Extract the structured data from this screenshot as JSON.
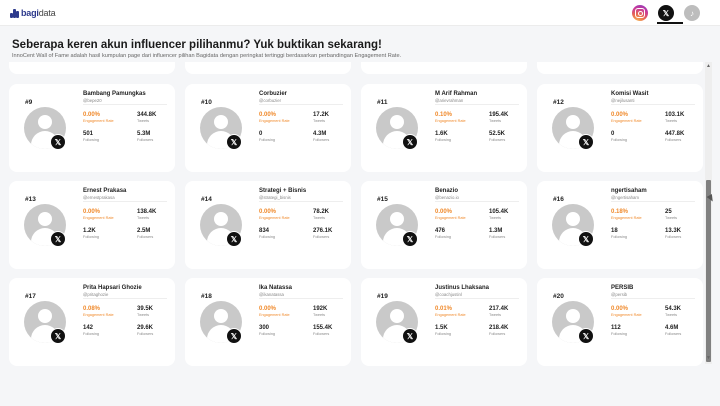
{
  "header": {
    "logo_bold": "bagi",
    "logo_thin": "data",
    "platforms": [
      {
        "name": "instagram",
        "icon": "instagram-icon"
      },
      {
        "name": "x",
        "icon": "x-logo-icon",
        "label": "𝕏",
        "active": true
      },
      {
        "name": "tiktok",
        "icon": "tiktok-icon",
        "label": "♪"
      }
    ]
  },
  "page": {
    "title": "Seberapa keren akun influencer pilihanmu? Yuk buktikan sekarang!",
    "subtitle": "InnoCent Wall of Fame adalah hasil kumpulan page dari influencer pilihan Bagidata dengan peringkat tertinggi berdasarkan perbandingan Engagement Rate."
  },
  "labels": {
    "engagement_rate": "Engagement Rate",
    "tweets": "Tweets",
    "following": "Following",
    "followers": "Followers",
    "x_badge": "𝕏"
  },
  "accent_color": "#f08a2c",
  "cards": [
    {
      "rank": "#9",
      "name": "Bambang Pamungkas",
      "handle": "@bepe20",
      "er": "0.00%",
      "tweets": "344.8K",
      "following": "501",
      "followers": "5.3M"
    },
    {
      "rank": "#10",
      "name": "Corbuzier",
      "handle": "@corbuzier",
      "er": "0.00%",
      "tweets": "17.2K",
      "following": "0",
      "followers": "4.3M"
    },
    {
      "rank": "#11",
      "name": "M Arif Rahman",
      "handle": "@arievrahman",
      "er": "0.10%",
      "tweets": "195.4K",
      "following": "1.6K",
      "followers": "52.5K"
    },
    {
      "rank": "#12",
      "name": "Komisi Wasit",
      "handle": "@nejilusanti",
      "er": "0.00%",
      "tweets": "103.1K",
      "following": "0",
      "followers": "447.8K"
    },
    {
      "rank": "#13",
      "name": "Ernest Prakasa",
      "handle": "@ernestprakasa",
      "er": "0.00%",
      "tweets": "138.4K",
      "following": "1.2K",
      "followers": "2.5M"
    },
    {
      "rank": "#14",
      "name": "Strategi + Bisnis",
      "handle": "@strategi_bisnis",
      "er": "0.00%",
      "tweets": "78.2K",
      "following": "834",
      "followers": "276.1K"
    },
    {
      "rank": "#15",
      "name": "Benazio",
      "handle": "@benazio.io",
      "er": "0.00%",
      "tweets": "105.4K",
      "following": "476",
      "followers": "1.3M"
    },
    {
      "rank": "#16",
      "name": "ngertisaham",
      "handle": "@ngertisaham",
      "er": "0.18%",
      "tweets": "25",
      "following": "18",
      "followers": "13.3K"
    },
    {
      "rank": "#17",
      "name": "Prita Hapsari Ghozie",
      "handle": "@pritaghozie",
      "er": "0.08%",
      "tweets": "39.5K",
      "following": "142",
      "followers": "29.6K"
    },
    {
      "rank": "#18",
      "name": "Ika Natassa",
      "handle": "@ikanatassa",
      "er": "0.00%",
      "tweets": "192K",
      "following": "300",
      "followers": "155.4K"
    },
    {
      "rank": "#19",
      "name": "Justinus Lhaksana",
      "handle": "@coachjustinl",
      "er": "0.01%",
      "tweets": "217.4K",
      "following": "1.5K",
      "followers": "218.4K"
    },
    {
      "rank": "#20",
      "name": "PERSIB",
      "handle": "@persib",
      "er": "0.00%",
      "tweets": "54.3K",
      "following": "112",
      "followers": "4.6M"
    }
  ]
}
